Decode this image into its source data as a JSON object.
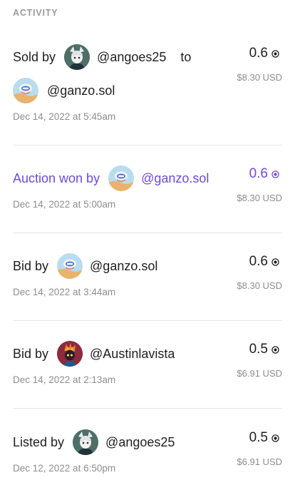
{
  "header": {
    "title": "ACTIVITY"
  },
  "colors": {
    "accent": "#6e4ad6",
    "muted": "#8d8d93",
    "divider": "#e6e6e8"
  },
  "activity": [
    {
      "verb": "Sold by",
      "actor": "@angoes25",
      "connector": "to",
      "recipient": "@ganzo.sol",
      "timestamp": "Dec 14, 2022 at 5:45am",
      "amount": "0.6",
      "usd": "$8.30 USD",
      "actor_avatar": "angoes25-avatar",
      "recipient_avatar": "ganzo-avatar"
    },
    {
      "verb": "Auction won by",
      "actor": "@ganzo.sol",
      "timestamp": "Dec 14, 2022 at 5:00am",
      "amount": "0.6",
      "usd": "$8.30 USD",
      "actor_avatar": "ganzo-avatar",
      "highlight": true
    },
    {
      "verb": "Bid by",
      "actor": "@ganzo.sol",
      "timestamp": "Dec 14, 2022 at 3:44am",
      "amount": "0.6",
      "usd": "$8.30 USD",
      "actor_avatar": "ganzo-avatar"
    },
    {
      "verb": "Bid by",
      "actor": "@Austinlavista",
      "timestamp": "Dec 14, 2022 at 2:13am",
      "amount": "0.5",
      "usd": "$6.91 USD",
      "actor_avatar": "austinlavista-avatar"
    },
    {
      "verb": "Listed by",
      "actor": "@angoes25",
      "timestamp": "Dec 12, 2022 at 6:50pm",
      "amount": "0.5",
      "usd": "$6.91 USD",
      "actor_avatar": "angoes25-avatar"
    }
  ]
}
